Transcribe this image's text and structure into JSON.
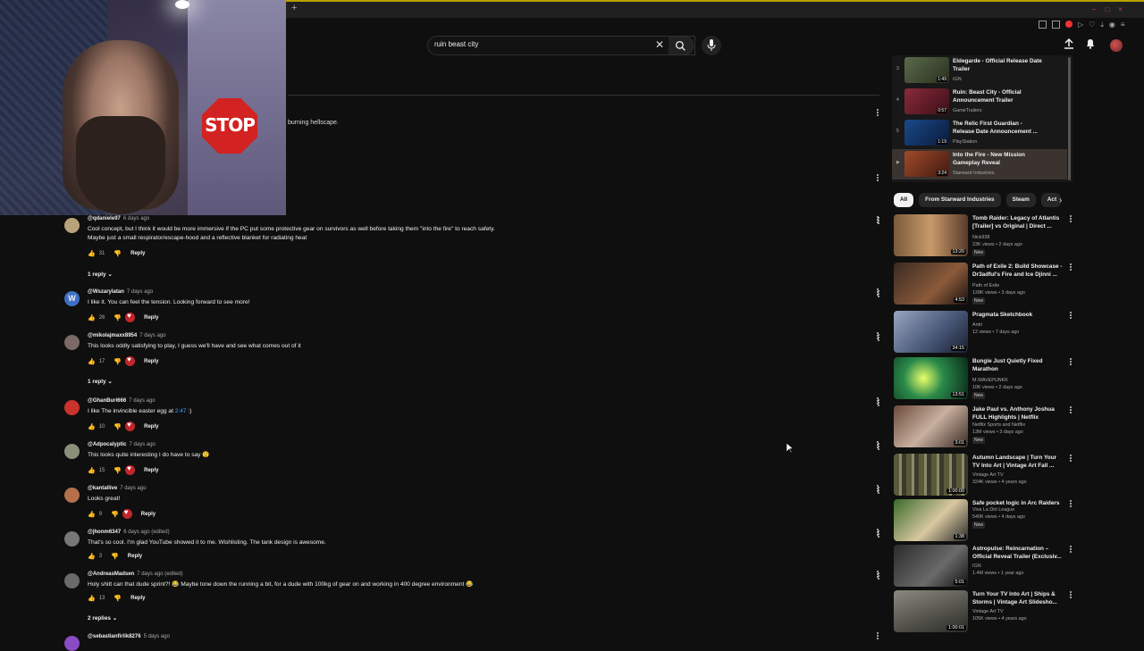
{
  "search": {
    "query": "ruin beast city"
  },
  "description_snippet": "burning hellscape.",
  "webcam": {
    "sign_text": "STOP"
  },
  "comments": [
    {
      "handle": "@qdaniele97",
      "time": "6 days ago",
      "text": "Cool concept, but I think it would be more immersive if the PC put some protective gear on survivors as well before taking them \"into the fire\" to reach safety.",
      "text2": "Maybe just a small respirator/escape-hood and a reflective blanket for radiating heat",
      "likes": "31",
      "reply_label": "Reply",
      "replies_label": "1 reply",
      "avatar_color": "#b8a27a"
    },
    {
      "handle": "@Wszarylatan",
      "time": "7 days ago",
      "text": "I like it. You can feel the tension. Looking forward to see more!",
      "likes": "26",
      "reply_label": "Reply",
      "avatar_color": "#3f6fc4",
      "avatar_letter": "W"
    },
    {
      "handle": "@mikolajmaxx8954",
      "time": "7 days ago",
      "text": "This looks oddly satisfying to play, I guess we'll have and see what comes out of it",
      "likes": "17",
      "reply_label": "Reply",
      "replies_label": "1 reply",
      "avatar_color": "#7a6a66"
    },
    {
      "handle": "@GhanBuri666",
      "time": "7 days ago",
      "text": "I like The invincible easter egg at",
      "timestamp_link": "2:47",
      "text_tail": " :)",
      "likes": "10",
      "reply_label": "Reply",
      "avatar_color": "#c9332c"
    },
    {
      "handle": "@Adpocalyptic",
      "time": "7 days ago",
      "text": "This looks quite interesting I do have to say 😲",
      "likes": "15",
      "reply_label": "Reply",
      "avatar_color": "#8a8f7a"
    },
    {
      "handle": "@kantallive",
      "time": "7 days ago",
      "text": "Looks great!",
      "likes": "9",
      "reply_label": "Reply",
      "avatar_color": "#b5704a"
    },
    {
      "handle": "@jhonm6347",
      "time": "6 days ago (edited)",
      "text": "That's so cool. I'm glad YouTube showed it to me. Wishlisting. The tank design is awesome.",
      "likes": "3",
      "reply_label": "Reply",
      "avatar_color": "#777"
    },
    {
      "handle": "@AndreasMadsen",
      "time": "7 days ago (edited)",
      "text": "Holy shitt can that dude sprint?! 😂 Maybe tone down the running a bit, for a dude with 100kg of gear on and working in 400 degree environment 😂",
      "likes": "13",
      "reply_label": "Reply",
      "replies_label": "2 replies",
      "avatar_color": "#6a6a6a"
    },
    {
      "handle": "@sebastianfirlik8276",
      "time": "5 days ago",
      "avatar_color": "#8a4bc4"
    }
  ],
  "playlist": [
    {
      "num": "3",
      "title": "Eldegarde - Official Release Date Trailer",
      "channel": "IGN",
      "duration": "1:49",
      "color": "#5a6a4a"
    },
    {
      "num": "4",
      "title": "Ruin: Beast City - Official Announcement Trailer",
      "channel": "GameTrailers",
      "duration": "0:57",
      "color": "#8a2a3a"
    },
    {
      "num": "5",
      "title": "The Relic First Guardian - Release Date Announcement ...",
      "channel": "PlayStation",
      "duration": "1:19",
      "color": "#1a4a8a"
    },
    {
      "num": "▶",
      "title": "Into the Fire - New Mission Gameplay Reveal",
      "channel": "Starward Industries",
      "duration": "3:24",
      "color": "#a04a2a"
    }
  ],
  "chips": [
    "All",
    "From Starward Industries",
    "Steam",
    "Act"
  ],
  "recommendations": [
    {
      "title": "Tomb Raider: Legacy of Atlantis [Trailer] vs Original | Direct ...",
      "channel": "Nick938",
      "meta": "23K views • 2 days ago",
      "new": "New",
      "duration": "13:20",
      "color": "#7a5a3a"
    },
    {
      "title": "Path of Exile 2: Build Showcase - Dr3adful's Fire and Ice Djinni ...",
      "channel": "Path of Exile",
      "meta": "128K views • 3 days ago",
      "new": "New",
      "duration": "4:53",
      "color": "#3a2a22"
    },
    {
      "title": "Pragmata Sketchbook",
      "channel": "Antri",
      "meta": "12 views • 7 days ago",
      "new": "",
      "duration": "34:15",
      "color": "#4a5a7a"
    },
    {
      "title": "Bungie Just Quietly Fixed Marathon",
      "channel": "M.WAVEPUNKK",
      "meta": "10K views • 2 days ago",
      "new": "New",
      "duration": "13:51",
      "color": "#2a8a4a"
    },
    {
      "title": "Jake Paul vs. Anthony Joshua FULL Highlights | Netflix",
      "channel": "Netflix Sports and Netflix",
      "meta": "13M views • 3 days ago",
      "new": "New",
      "duration": "3:01",
      "color": "#6a4a3a"
    },
    {
      "title": "Autumn Landscape | Turn Your TV Into Art | Vintage Art Fall ...",
      "channel": "Vintage Art TV",
      "meta": "324K views • 4 years ago",
      "new": "",
      "duration": "1:00:00",
      "color": "#7a7a5a"
    },
    {
      "title": "Safe pocket logic in Arc Raiders",
      "channel": "Viva La Dirt League",
      "meta": "540K views • 4 days ago",
      "new": "New",
      "duration": "1:38",
      "color": "#3a6a2a"
    },
    {
      "title": "Astropulse: Reincarnation – Official Reveal Trailer (Exclusiv...",
      "channel": "IGN",
      "meta": "1.4M views • 1 year ago",
      "new": "",
      "duration": "5:01",
      "color": "#2a2a2a"
    },
    {
      "title": "Turn Your TV Into Art | Ships & Storms | Vintage Art Slidesho...",
      "channel": "Vintage Art TV",
      "meta": "105K views • 4 years ago",
      "new": "",
      "duration": "1:00:01",
      "color": "#5a5a52"
    }
  ]
}
